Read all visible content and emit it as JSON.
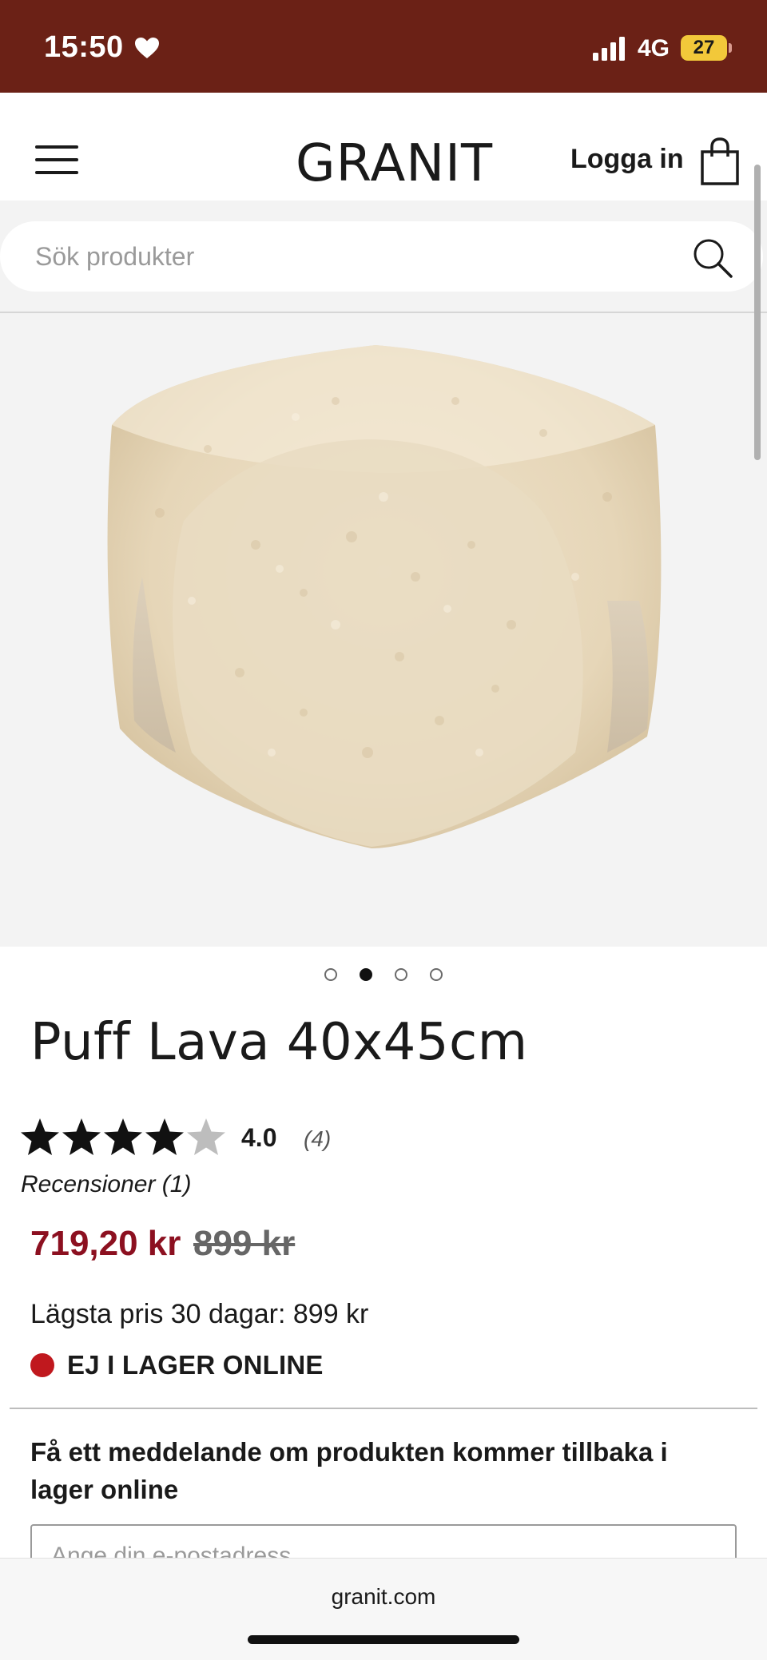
{
  "status_bar": {
    "time": "15:50",
    "network": "4G",
    "battery_level": "27"
  },
  "header": {
    "logo": "GRANIT",
    "login_label": "Logga in"
  },
  "search": {
    "placeholder": "Sök produkter"
  },
  "carousel": {
    "total": 4,
    "active_index": 1
  },
  "product": {
    "title": "Puff Lava 40x45cm",
    "rating": {
      "value": "4.0",
      "count": "(4)",
      "stars_filled": 4,
      "stars_total": 5
    },
    "reviews_label": "Recensioner (1)",
    "price_sale": "719,20 kr",
    "price_original": "899 kr",
    "lowest_price_text": "Lägsta pris 30 dagar: 899 kr",
    "stock_status": "EJ I LAGER ONLINE"
  },
  "notify": {
    "text": "Få ett meddelande om produkten kommer tillbaka i lager online",
    "email_placeholder": "Ange din e-postadress"
  },
  "browser": {
    "url": "granit.com"
  },
  "colors": {
    "status_bar_bg": "#6b2116",
    "sale_price": "#8c1020",
    "stock_dot": "#c0181e",
    "battery": "#f2c83a"
  }
}
